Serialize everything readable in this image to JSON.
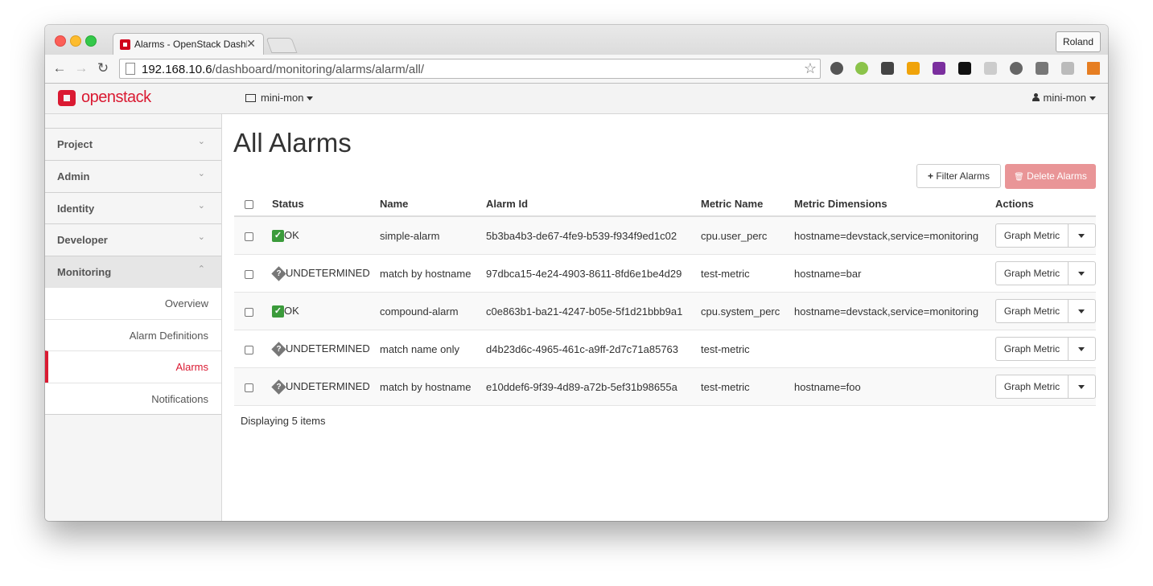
{
  "browser": {
    "tab_title": "Alarms - OpenStack Dashb",
    "tab_close": "✕",
    "profile_name": "Roland",
    "url_host": "192.168.10.6",
    "url_path": "/dashboard/monitoring/alarms/alarm/all/",
    "back": "←",
    "forward": "→",
    "reload": "↻",
    "star": "☆"
  },
  "header": {
    "logo_text": "openstack",
    "project": "mini-mon",
    "user": "mini-mon"
  },
  "sidebar": {
    "sections": [
      {
        "label": "Project",
        "chevron": "⌄"
      },
      {
        "label": "Admin",
        "chevron": "⌄"
      },
      {
        "label": "Identity",
        "chevron": "⌄"
      },
      {
        "label": "Developer",
        "chevron": "⌄"
      },
      {
        "label": "Monitoring",
        "chevron": "⌃"
      }
    ],
    "items": [
      {
        "label": "Overview"
      },
      {
        "label": "Alarm Definitions"
      },
      {
        "label": "Alarms"
      },
      {
        "label": "Notifications"
      }
    ]
  },
  "main": {
    "title": "All Alarms",
    "filter_button": "Filter Alarms",
    "delete_button": "Delete Alarms",
    "filter_icon": "+",
    "delete_icon": "🗑",
    "columns": [
      "Status",
      "Name",
      "Alarm Id",
      "Metric Name",
      "Metric Dimensions",
      "Actions"
    ],
    "rows": [
      {
        "status": "OK",
        "status_icon": "✓",
        "name": "simple-alarm",
        "alarm_id": "5b3ba4b3-de67-4fe9-b539-f934f9ed1c02",
        "metric": "cpu.user_perc",
        "dimensions": "hostname=devstack,service=monitoring",
        "action": "Graph Metric"
      },
      {
        "status": "UNDETERMINED",
        "status_icon": "?",
        "name": "match by hostname",
        "alarm_id": "97dbca15-4e24-4903-8611-8fd6e1be4d29",
        "metric": "test-metric",
        "dimensions": "hostname=bar",
        "action": "Graph Metric"
      },
      {
        "status": "OK",
        "status_icon": "✓",
        "name": "compound-alarm",
        "alarm_id": "c0e863b1-ba21-4247-b05e-5f1d21bbb9a1",
        "metric": "cpu.system_perc",
        "dimensions": "hostname=devstack,service=monitoring",
        "action": "Graph Metric"
      },
      {
        "status": "UNDETERMINED",
        "status_icon": "?",
        "name": "match name only",
        "alarm_id": "d4b23d6c-4965-461c-a9ff-2d7c71a85763",
        "metric": "test-metric",
        "dimensions": "",
        "action": "Graph Metric"
      },
      {
        "status": "UNDETERMINED",
        "status_icon": "?",
        "name": "match by hostname",
        "alarm_id": "e10ddef6-9f39-4d89-a72b-5ef31b98655a",
        "metric": "test-metric",
        "dimensions": "hostname=foo",
        "action": "Graph Metric"
      }
    ],
    "count_text": "Displaying 5 items"
  },
  "colors": {
    "accent": "#da1a32",
    "ok": "#3b9b3b",
    "delete_disabled": "#e99597"
  }
}
